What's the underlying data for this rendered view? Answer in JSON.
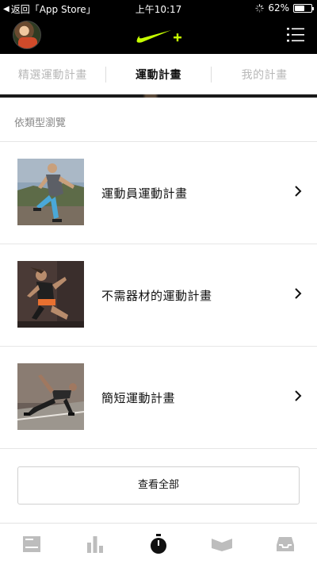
{
  "status_bar": {
    "back_label": "返回「App Store」",
    "time": "上午10:17",
    "battery": "62%",
    "battery_level": 0.62
  },
  "nav": {
    "logo_color": "#c6ff00"
  },
  "tabs": [
    {
      "label": "精選運動計畫",
      "active": false
    },
    {
      "label": "運動計畫",
      "active": true
    },
    {
      "label": "我的計畫",
      "active": false
    }
  ],
  "section_header": "依類型瀏覽",
  "items": [
    {
      "label": "運動員運動計畫",
      "icon": "athlete-photo"
    },
    {
      "label": "不需器材的運動計畫",
      "icon": "no-equipment-photo"
    },
    {
      "label": "簡短運動計畫",
      "icon": "quick-workout-photo"
    }
  ],
  "view_all_label": "查看全部",
  "tab_bar": [
    {
      "icon": "feed-icon",
      "active": false
    },
    {
      "icon": "activity-icon",
      "active": false
    },
    {
      "icon": "workout-timer-icon",
      "active": true
    },
    {
      "icon": "programs-icon",
      "active": false
    },
    {
      "icon": "inbox-icon",
      "active": false
    }
  ]
}
